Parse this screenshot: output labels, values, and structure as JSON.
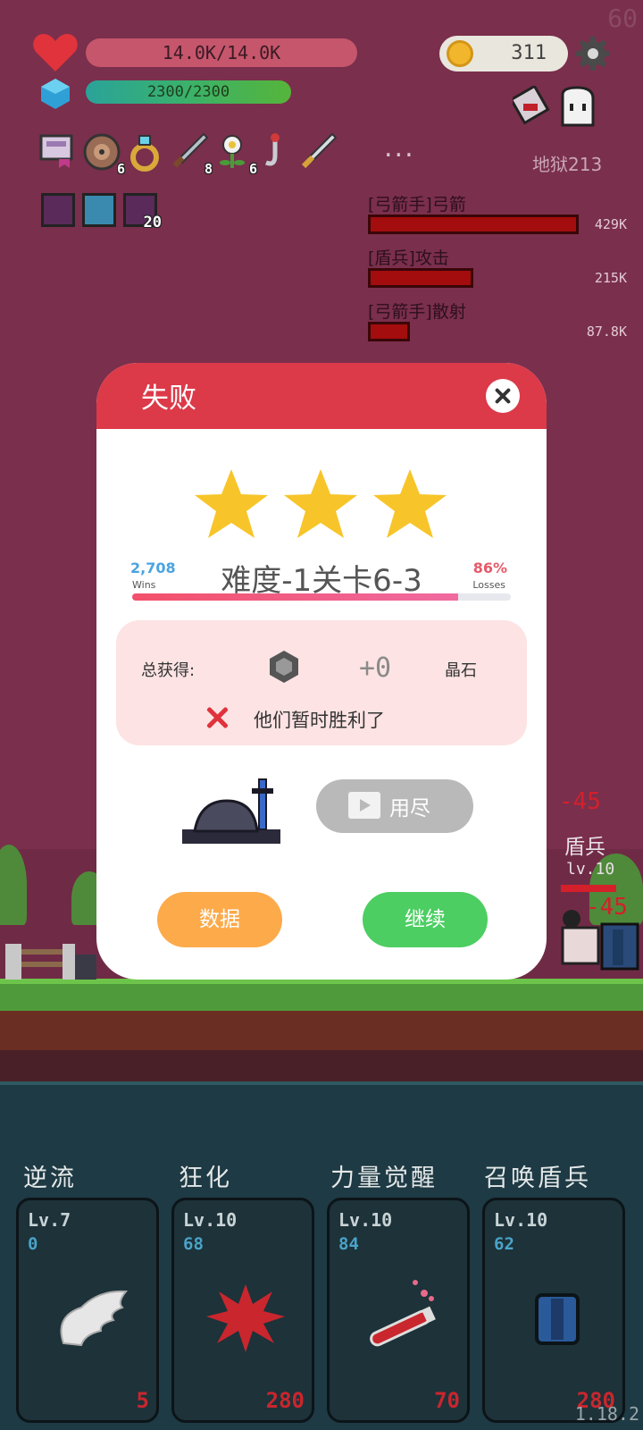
{
  "hud": {
    "hp_text": "14.0K/14.0K",
    "mp_text": "2300/2300",
    "coins": "311",
    "fps": "60",
    "hell_level": "地狱213",
    "more": "...",
    "items": [
      {
        "icon": "banner-icon",
        "count": ""
      },
      {
        "icon": "shield-icon",
        "count": "6"
      },
      {
        "icon": "ring-icon",
        "count": ""
      },
      {
        "icon": "sword-icon",
        "count": "8"
      },
      {
        "icon": "flower-icon",
        "count": "6"
      },
      {
        "icon": "hook-icon",
        "count": ""
      },
      {
        "icon": "dagger-icon",
        "count": ""
      }
    ],
    "buffs": [
      {
        "icon": "demon-buff-icon",
        "count": ""
      },
      {
        "icon": "light-buff-icon",
        "count": ""
      },
      {
        "icon": "demon-stack-icon",
        "count": "20"
      }
    ]
  },
  "damage_list": [
    {
      "name": "[弓箭手]弓箭",
      "value": "429K",
      "fraction": 1.0
    },
    {
      "name": "[盾兵]攻击",
      "value": "215K",
      "fraction": 0.5
    },
    {
      "name": "[弓箭手]散射",
      "value": "87.8K",
      "fraction": 0.2
    }
  ],
  "enemy": {
    "damage_top": "-45",
    "damage_bottom": "-45",
    "name": "盾兵",
    "level": "lv.10"
  },
  "dialog": {
    "title": "失败",
    "stars": 3,
    "stage_name": "难度-1关卡6-3",
    "wins_value": "2,708",
    "wins_label": "Wins",
    "losses_value": "86%",
    "losses_label": "Losses",
    "win_fraction": 0.86,
    "reward_label": "总获得:",
    "reward_amount": "+0",
    "reward_unit": "晶石",
    "fail_message": "他们暂时胜利了",
    "video_button": "用尽",
    "data_button": "数据",
    "continue_button": "继续"
  },
  "skills": [
    {
      "title": "逆流",
      "level": "Lv.7",
      "count": "0",
      "cost": "5",
      "icon": "wing-icon"
    },
    {
      "title": "狂化",
      "level": "Lv.10",
      "count": "68",
      "cost": "280",
      "icon": "blood-splat-icon"
    },
    {
      "title": "力量觉醒",
      "level": "Lv.10",
      "count": "84",
      "cost": "70",
      "icon": "potion-icon"
    },
    {
      "title": "召唤盾兵",
      "level": "Lv.10",
      "count": "62",
      "cost": "280",
      "icon": "shield-summon-icon"
    }
  ],
  "version": "1.18.2",
  "colors": {
    "background": "#7a2f4c",
    "dialog_header": "#dc3a49",
    "data_button": "#fdaa4a",
    "continue_button": "#4cce62",
    "skill_panel": "#1e3a44"
  }
}
